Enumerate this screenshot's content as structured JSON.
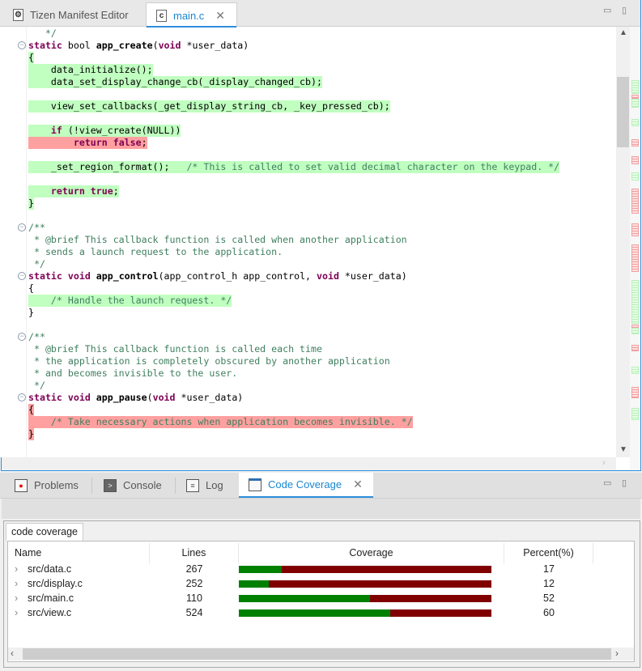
{
  "editor": {
    "tabs": [
      {
        "label": "Tizen Manifest Editor",
        "icon": "manifest-gear-icon",
        "active": false
      },
      {
        "label": "main.c",
        "icon": "c-file-icon",
        "icon_text": "c",
        "active": true
      }
    ],
    "minimize": "▭",
    "maximize": "▯",
    "code_lines": [
      {
        "hl": "",
        "t": [
          [
            "c",
            "   */"
          ]
        ]
      },
      {
        "hl": "",
        "fold": true,
        "t": [
          [
            "k",
            "static"
          ],
          [
            "p",
            " bool "
          ],
          [
            "f",
            "app_create"
          ],
          [
            "p",
            "("
          ],
          [
            "k",
            "void"
          ],
          [
            "p",
            " *user_data)"
          ]
        ]
      },
      {
        "hl": "g",
        "t": [
          [
            "p",
            "{"
          ]
        ]
      },
      {
        "hl": "g",
        "t": [
          [
            "p",
            "    data_initialize();"
          ]
        ]
      },
      {
        "hl": "g",
        "t": [
          [
            "p",
            "    data_set_display_change_cb(_display_changed_cb);"
          ]
        ]
      },
      {
        "hl": "",
        "t": []
      },
      {
        "hl": "g",
        "t": [
          [
            "p",
            "    view_set_callbacks(_get_display_string_cb, _key_pressed_cb);"
          ]
        ]
      },
      {
        "hl": "",
        "t": []
      },
      {
        "hl": "g",
        "t": [
          [
            "p",
            "    "
          ],
          [
            "k",
            "if"
          ],
          [
            "p",
            " (!view_create(NULL))"
          ]
        ]
      },
      {
        "hl": "r",
        "t": [
          [
            "p",
            "        "
          ],
          [
            "k",
            "return"
          ],
          [
            "p",
            " "
          ],
          [
            "k",
            "false"
          ],
          [
            "p",
            ";"
          ]
        ]
      },
      {
        "hl": "",
        "t": []
      },
      {
        "hl": "g",
        "t": [
          [
            "p",
            "    _set_region_format();   "
          ],
          [
            "c",
            "/* This is called to set valid decimal character on the keypad. */"
          ]
        ]
      },
      {
        "hl": "",
        "t": []
      },
      {
        "hl": "g",
        "t": [
          [
            "p",
            "    "
          ],
          [
            "k",
            "return"
          ],
          [
            "p",
            " "
          ],
          [
            "k",
            "true"
          ],
          [
            "p",
            ";"
          ]
        ]
      },
      {
        "hl": "g",
        "t": [
          [
            "p",
            "}"
          ]
        ]
      },
      {
        "hl": "",
        "t": []
      },
      {
        "hl": "",
        "fold": true,
        "t": [
          [
            "c",
            "/**"
          ]
        ]
      },
      {
        "hl": "",
        "t": [
          [
            "c",
            " * @brief This callback function is called when another application"
          ]
        ]
      },
      {
        "hl": "",
        "t": [
          [
            "c",
            " * sends a launch request to the application."
          ]
        ]
      },
      {
        "hl": "",
        "t": [
          [
            "c",
            " */"
          ]
        ]
      },
      {
        "hl": "",
        "fold": true,
        "t": [
          [
            "k",
            "static"
          ],
          [
            "p",
            " "
          ],
          [
            "k",
            "void"
          ],
          [
            "p",
            " "
          ],
          [
            "f",
            "app_control"
          ],
          [
            "p",
            "(app_control_h app_control, "
          ],
          [
            "k",
            "void"
          ],
          [
            "p",
            " *user_data)"
          ]
        ]
      },
      {
        "hl": "",
        "t": [
          [
            "p",
            "{"
          ]
        ]
      },
      {
        "hl": "g",
        "t": [
          [
            "p",
            "    "
          ],
          [
            "c",
            "/* Handle the launch request. */"
          ]
        ]
      },
      {
        "hl": "",
        "t": [
          [
            "p",
            "}"
          ]
        ]
      },
      {
        "hl": "",
        "t": []
      },
      {
        "hl": "",
        "fold": true,
        "t": [
          [
            "c",
            "/**"
          ]
        ]
      },
      {
        "hl": "",
        "t": [
          [
            "c",
            " * @brief This callback function is called each time"
          ]
        ]
      },
      {
        "hl": "",
        "t": [
          [
            "c",
            " * the application is completely obscured by another application"
          ]
        ]
      },
      {
        "hl": "",
        "t": [
          [
            "c",
            " * and becomes invisible to the user."
          ]
        ]
      },
      {
        "hl": "",
        "t": [
          [
            "c",
            " */"
          ]
        ]
      },
      {
        "hl": "",
        "fold": true,
        "t": [
          [
            "k",
            "static"
          ],
          [
            "p",
            " "
          ],
          [
            "k",
            "void"
          ],
          [
            "p",
            " "
          ],
          [
            "f",
            "app_pause"
          ],
          [
            "p",
            "("
          ],
          [
            "k",
            "void"
          ],
          [
            "p",
            " *user_data)"
          ]
        ]
      },
      {
        "hl": "r",
        "t": [
          [
            "p",
            "{"
          ]
        ]
      },
      {
        "hl": "r",
        "t": [
          [
            "p",
            "    "
          ],
          [
            "c",
            "/* Take necessary actions when application becomes invisible. */"
          ]
        ]
      },
      {
        "hl": "r",
        "t": [
          [
            "p",
            "}"
          ]
        ]
      }
    ],
    "overview_markers": [
      "g",
      "r",
      "g",
      "g",
      "r",
      "r",
      "g",
      "r",
      "r",
      "r",
      "g",
      "r",
      "g",
      "r",
      "g",
      "r",
      "g"
    ]
  },
  "panel": {
    "tabs": [
      {
        "label": "Problems",
        "icon": "problems-icon",
        "active": false
      },
      {
        "label": "Console",
        "icon": "console-icon",
        "active": false
      },
      {
        "label": "Log",
        "icon": "log-icon",
        "active": false
      },
      {
        "label": "Code Coverage",
        "icon": "code-coverage-icon",
        "active": true
      }
    ],
    "inner_tab": "code coverage",
    "columns": [
      "Name",
      "Lines",
      "Coverage",
      "Percent(%)"
    ],
    "rows": [
      {
        "name": "src/data.c",
        "lines": "267",
        "percent": "17"
      },
      {
        "name": "src/display.c",
        "lines": "252",
        "percent": "12"
      },
      {
        "name": "src/main.c",
        "lines": "110",
        "percent": "52"
      },
      {
        "name": "src/view.c",
        "lines": "524",
        "percent": "60"
      }
    ],
    "colors": {
      "covered": "#008000",
      "uncovered": "#800000"
    }
  }
}
